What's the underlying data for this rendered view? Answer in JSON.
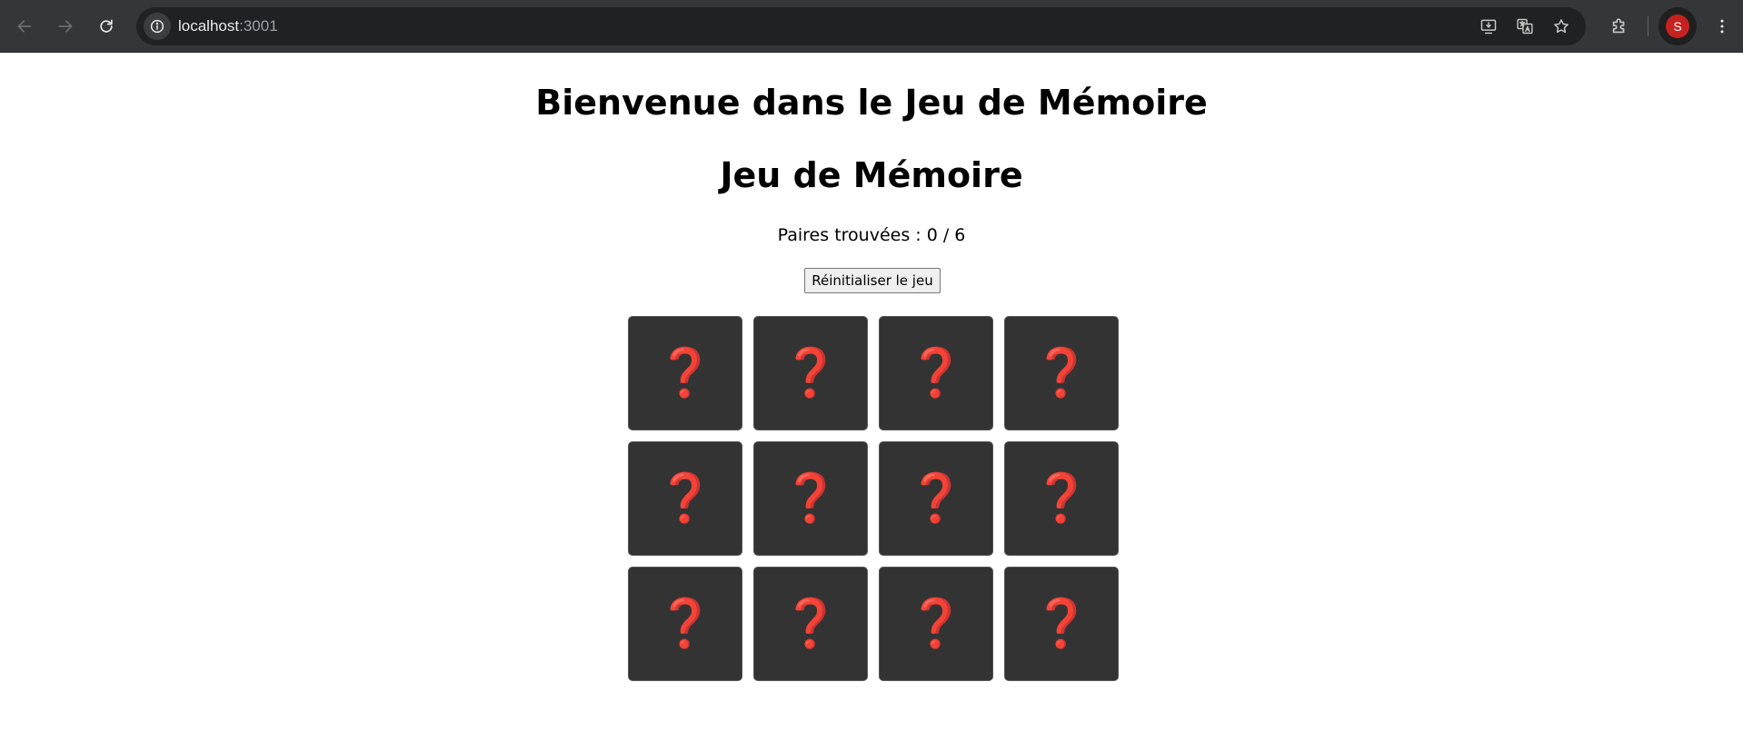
{
  "browser": {
    "url_host": "localhost",
    "url_port": ":3001",
    "profile_initial": "S",
    "icons": {
      "back": "arrow-left-icon",
      "forward": "arrow-right-icon",
      "reload": "reload-icon",
      "site_info": "info-icon",
      "install": "install-app-icon",
      "translate": "translate-icon",
      "bookmark": "star-icon",
      "extensions": "puzzle-icon",
      "menu": "kebab-menu-icon"
    }
  },
  "page": {
    "heading": "Bienvenue dans le Jeu de Mémoire",
    "title": "Jeu de Mémoire",
    "score_label": "Paires trouvées : 0 / 6",
    "reset_label": "Réinitialiser le jeu",
    "card_back_symbol": "❓",
    "cards": [
      {
        "face": "❓"
      },
      {
        "face": "❓"
      },
      {
        "face": "❓"
      },
      {
        "face": "❓"
      },
      {
        "face": "❓"
      },
      {
        "face": "❓"
      },
      {
        "face": "❓"
      },
      {
        "face": "❓"
      },
      {
        "face": "❓"
      },
      {
        "face": "❓"
      },
      {
        "face": "❓"
      },
      {
        "face": "❓"
      }
    ]
  },
  "colors": {
    "card_background": "#333333",
    "question_mark": "#e3262c",
    "toolbar": "#35363a",
    "avatar": "#c5221f"
  }
}
